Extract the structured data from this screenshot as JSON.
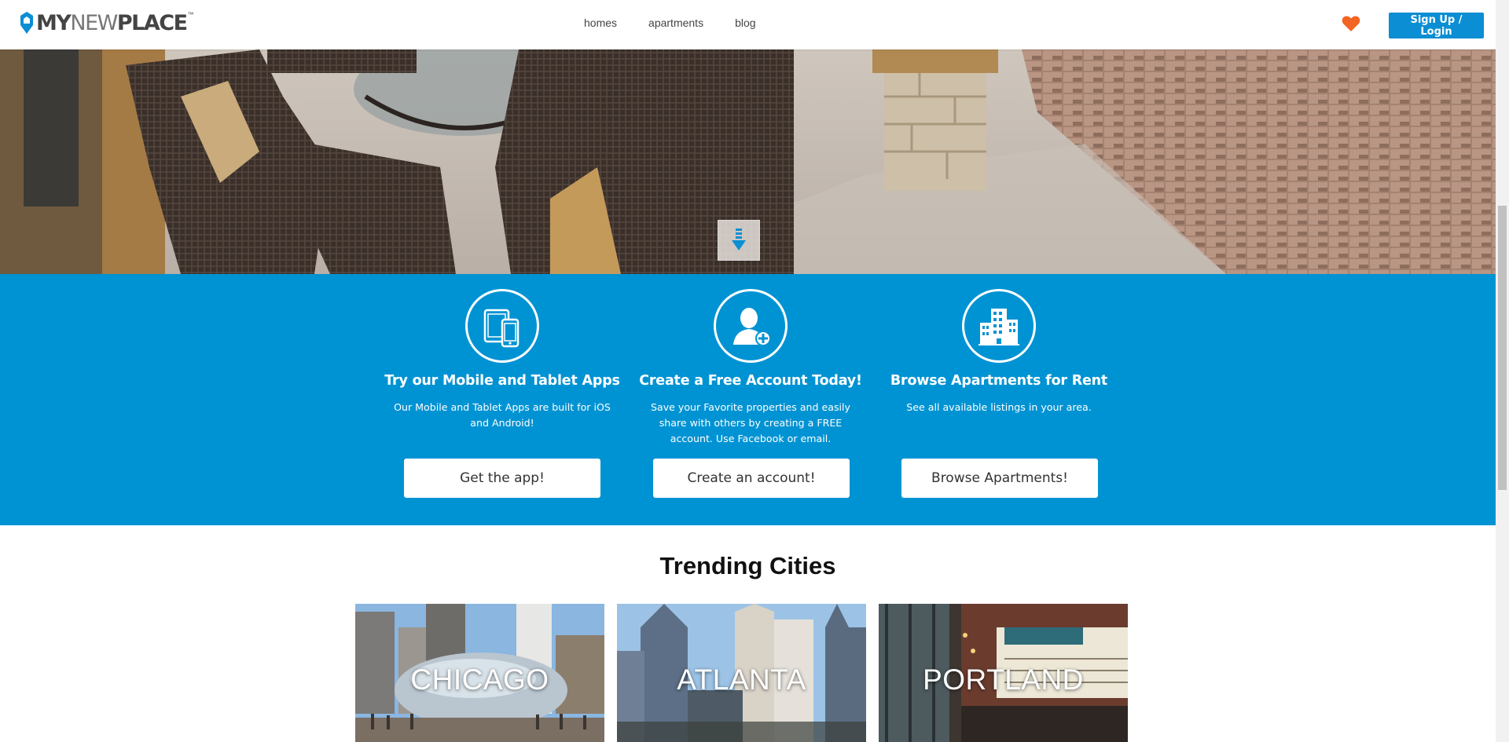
{
  "header": {
    "logo": {
      "part1": "MY",
      "part2": "NEW",
      "part3": "PLACE",
      "tm": "™"
    },
    "nav": [
      {
        "label": "homes"
      },
      {
        "label": "apartments"
      },
      {
        "label": "blog"
      }
    ],
    "signup_label": "Sign Up / Login"
  },
  "features": [
    {
      "icon": "mobile-tablet-icon",
      "title": "Try our Mobile and Tablet Apps",
      "description": "Our Mobile and Tablet Apps are built for iOS and Android!",
      "button": "Get the app!"
    },
    {
      "icon": "add-user-icon",
      "title": "Create a Free Account Today!",
      "description": "Save your Favorite properties and easily share with others by creating a FREE account. Use Facebook or email.",
      "button": "Create an account!"
    },
    {
      "icon": "buildings-icon",
      "title": "Browse Apartments for Rent",
      "description": "See all available listings in your area.",
      "button": "Browse Apartments!"
    }
  ],
  "trending": {
    "title": "Trending Cities",
    "cities": [
      {
        "name": "CHICAGO"
      },
      {
        "name": "ATLANTA"
      },
      {
        "name": "PORTLAND"
      }
    ]
  },
  "colors": {
    "brand_blue": "#0093d3",
    "button_blue": "#0b8ed3",
    "heart_orange": "#f26522"
  }
}
